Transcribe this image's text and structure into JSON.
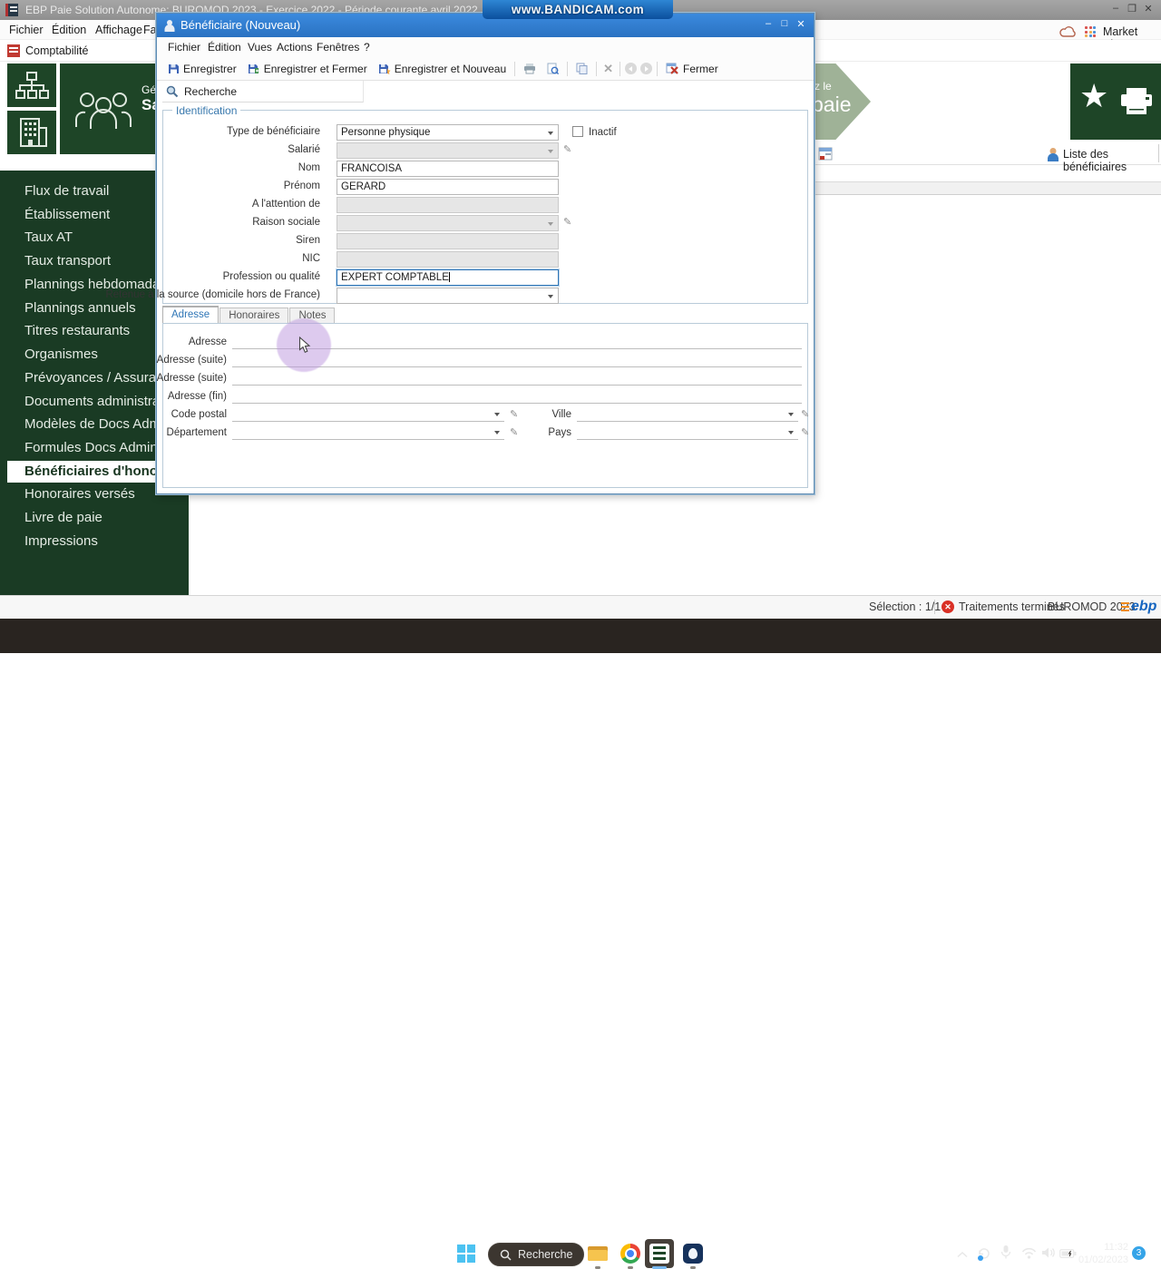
{
  "watermark": "www.BANDICAM.com",
  "icons": {
    "star": "★",
    "minimize": "–",
    "maximize": "□",
    "restore": "❐",
    "close": "✕"
  },
  "main_window": {
    "title": "EBP Paie Solution Autonome: BUROMOD 2023 - Exercice 2022 - Période courante avril 2022",
    "menu": [
      {
        "label": "Fichier"
      },
      {
        "label": "Édition"
      },
      {
        "label": "Affichage"
      },
      {
        "label": "Favoris"
      }
    ],
    "comptabilite_label": "Comptabilité",
    "market_place_label": "Market Place",
    "people_tile": {
      "line1": "Gé",
      "line2": "Sa"
    },
    "paie_tile": {
      "line1": "z le",
      "line2": "paie"
    },
    "liste_toolbar_label": "Liste des bénéficiaires"
  },
  "sidebar": {
    "items": [
      {
        "label": "Flux de travail",
        "selected": false
      },
      {
        "label": "Établissement",
        "selected": false
      },
      {
        "label": "Taux AT",
        "selected": false
      },
      {
        "label": "Taux transport",
        "selected": false
      },
      {
        "label": "Plannings hebdomadaires",
        "selected": false
      },
      {
        "label": "Plannings annuels",
        "selected": false
      },
      {
        "label": "Titres restaurants",
        "selected": false
      },
      {
        "label": "Organismes",
        "selected": false
      },
      {
        "label": "Prévoyances / Assurances",
        "selected": false
      },
      {
        "label": "Documents administratifs",
        "selected": false
      },
      {
        "label": "Modèles de Docs Admin",
        "selected": false
      },
      {
        "label": "Formules Docs Admin",
        "selected": false
      },
      {
        "label": "Bénéficiaires d'honoraires",
        "selected": true
      },
      {
        "label": "Honoraires versés",
        "selected": false
      },
      {
        "label": "Livre de paie",
        "selected": false
      },
      {
        "label": "Impressions",
        "selected": false
      }
    ]
  },
  "dialog": {
    "title": "Bénéficiaire (Nouveau)",
    "menu": [
      {
        "label": "Fichier"
      },
      {
        "label": "Édition"
      },
      {
        "label": "Vues"
      },
      {
        "label": "Actions"
      },
      {
        "label": "Fenêtres"
      },
      {
        "label": "?"
      }
    ],
    "toolbar": {
      "save": "Enregistrer",
      "save_close": "Enregistrer et Fermer",
      "save_new": "Enregistrer et Nouveau",
      "close": "Fermer"
    },
    "search_label": "Recherche",
    "identification": {
      "legend": "Identification",
      "type_label": "Type de bénéficiaire",
      "type_value": "Personne physique",
      "inactif_label": "Inactif",
      "salarie_label": "Salarié",
      "nom_label": "Nom",
      "nom_value": "FRANCOISA",
      "prenom_label": "Prénom",
      "prenom_value": "GERARD",
      "attention_label": "A l'attention de",
      "raison_label": "Raison sociale",
      "siren_label": "Siren",
      "nic_label": "NIC",
      "profession_label": "Profession ou qualité",
      "profession_value": "EXPERT COMPTABLE",
      "retenue_label": "Retenue à la source (domicile hors de France)"
    },
    "tabs": [
      {
        "label": "Adresse"
      },
      {
        "label": "Honoraires"
      },
      {
        "label": "Notes"
      }
    ],
    "address": {
      "adresse_label": "Adresse",
      "adresse_suite1_label": "Adresse (suite)",
      "adresse_suite2_label": "Adresse (suite)",
      "adresse_fin_label": "Adresse (fin)",
      "code_postal_label": "Code postal",
      "ville_label": "Ville",
      "departement_label": "Département",
      "pays_label": "Pays"
    }
  },
  "statusbar": {
    "selection": "Sélection : 1/1",
    "treatments": "Traitements terminés",
    "product": "BUROMOD 2023",
    "logo_text": "ebp"
  },
  "taskbar": {
    "search_placeholder": "Recherche",
    "time": "11:32",
    "date": "01/02/2023",
    "badge": "3"
  },
  "colors": {
    "sidebar_green": "#1a3b24",
    "tile_green": "#1e4527",
    "dialog_titlebar_blue": "#2e7fd6",
    "accent_blue": "#2e75b6",
    "sage_arrow": "#9fb297",
    "taskbar_dark": "#292420",
    "status_error_red": "#d93025"
  }
}
